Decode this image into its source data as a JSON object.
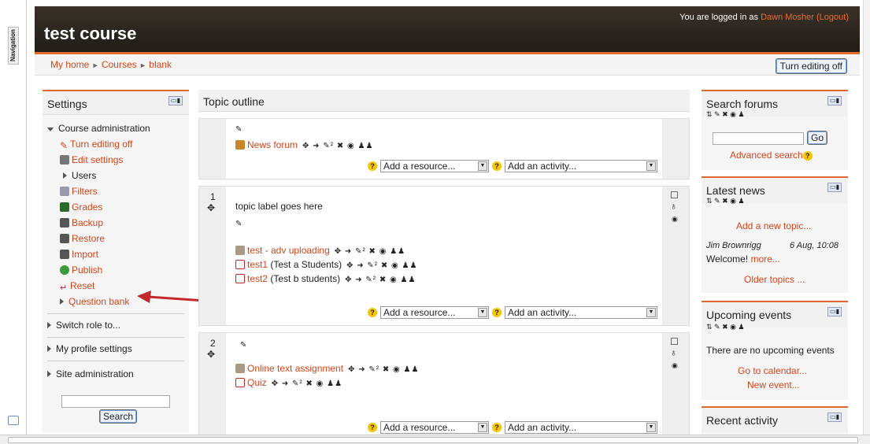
{
  "header": {
    "course_title": "test course",
    "login_prefix": "You are logged in as ",
    "user_name": "Dawn Mosher",
    "logout": "(Logout)"
  },
  "breadcrumb": {
    "home": "My home",
    "courses": "Courses",
    "current": "blank",
    "sep": "►"
  },
  "turn_editing_off_button": "Turn editing off",
  "dock": {
    "tab_label": "Navigation"
  },
  "settings": {
    "title": "Settings",
    "course_admin": "Course administration",
    "items": [
      "Turn editing off",
      "Edit settings",
      "Users",
      "Filters",
      "Grades",
      "Backup",
      "Restore",
      "Import",
      "Publish",
      "Reset",
      "Question bank"
    ],
    "switch_role": "Switch role to...",
    "profile": "My profile settings",
    "site_admin": "Site administration",
    "search_button": "Search"
  },
  "main": {
    "topic_outline": "Topic outline",
    "news_forum": "News forum",
    "add_resource": "Add a resource...",
    "add_activity": "Add an activity...",
    "topic1_num": "1",
    "topic1_label": "topic label goes here",
    "t1_items": [
      "test - adv uploading",
      "test1",
      "test2"
    ],
    "t1_suffix": [
      "",
      "(Test a Students)",
      "(Test b students)"
    ],
    "topic2_num": "2",
    "t2_items": [
      "Online text assignment",
      "Quiz"
    ]
  },
  "search_forums": {
    "title": "Search forums",
    "go": "Go",
    "advanced": "Advanced search"
  },
  "latest_news": {
    "title": "Latest news",
    "add_topic": "Add a new topic...",
    "author": "Jim Brownrigg",
    "date": "6 Aug, 10:08",
    "message": "Welcome!",
    "more": "more...",
    "older": "Older topics ..."
  },
  "upcoming": {
    "title": "Upcoming events",
    "none": "There are no upcoming events",
    "calendar": "Go to calendar...",
    "new_event": "New event..."
  },
  "recent": {
    "title": "Recent activity"
  },
  "colors": {
    "accent": "#e0682d",
    "link": "#d0461c",
    "header_bg": "#2d2620",
    "arrow": "#c0282a"
  }
}
